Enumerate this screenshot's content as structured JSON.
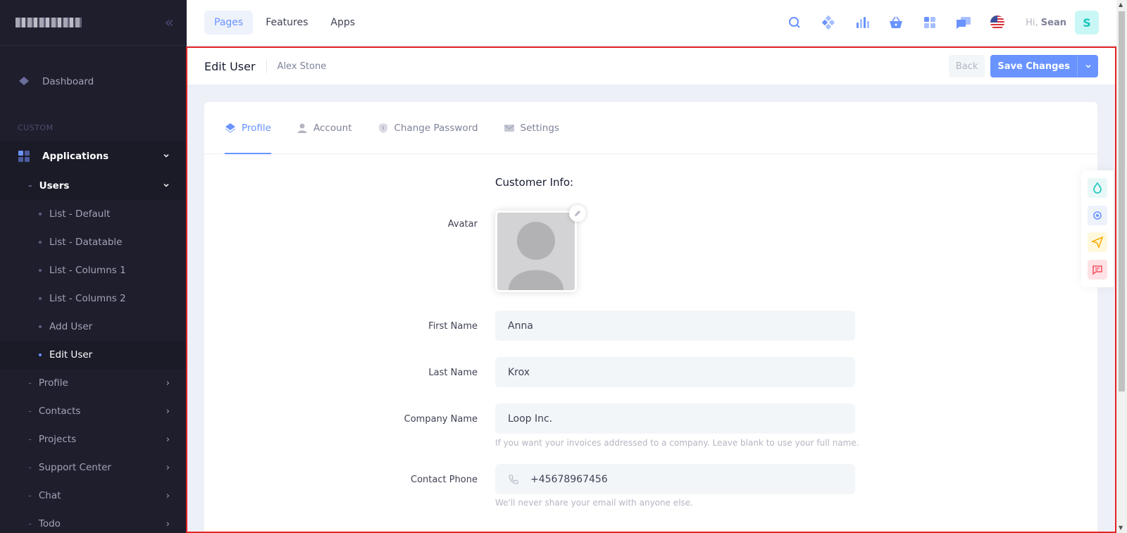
{
  "sidebar": {
    "dashboard": "Dashboard",
    "section": "CUSTOM",
    "applications": "Applications",
    "users": "Users",
    "user_items": [
      "List - Default",
      "List - Datatable",
      "List - Columns 1",
      "List - Columns 2",
      "Add User",
      "Edit User"
    ],
    "active_item": "Edit User",
    "other_items": [
      "Profile",
      "Contacts",
      "Projects",
      "Support Center",
      "Chat",
      "Todo"
    ]
  },
  "topbar": {
    "nav": [
      "Pages",
      "Features",
      "Apps"
    ],
    "active_nav": "Pages",
    "icons": [
      "search-icon",
      "diamond-icon",
      "chart-bars-icon",
      "basket-icon",
      "apps-icon",
      "chat-icon",
      "us-flag-icon"
    ],
    "greeting_prefix": "Hi,",
    "user_name": "Sean",
    "avatar_letter": "S"
  },
  "subheader": {
    "title": "Edit User",
    "subtitle": "Alex Stone",
    "back": "Back",
    "save": "Save Changes"
  },
  "tabs": [
    "Profile",
    "Account",
    "Change Password",
    "Settings"
  ],
  "active_tab": "Profile",
  "form": {
    "section_title": "Customer Info:",
    "avatar_label": "Avatar",
    "first_name_label": "First Name",
    "first_name": "Anna",
    "last_name_label": "Last Name",
    "last_name": "Krox",
    "company_label": "Company Name",
    "company": "Loop Inc.",
    "company_hint": "If you want your invoices addressed to a company. Leave blank to use your full name.",
    "phone_label": "Contact Phone",
    "phone": "+45678967456",
    "phone_hint": "We'll never share your email with anyone else."
  },
  "colors": {
    "primary": "#6993ff",
    "sidebar_bg": "#1e1e2d",
    "selection_frame": "#e12424"
  }
}
